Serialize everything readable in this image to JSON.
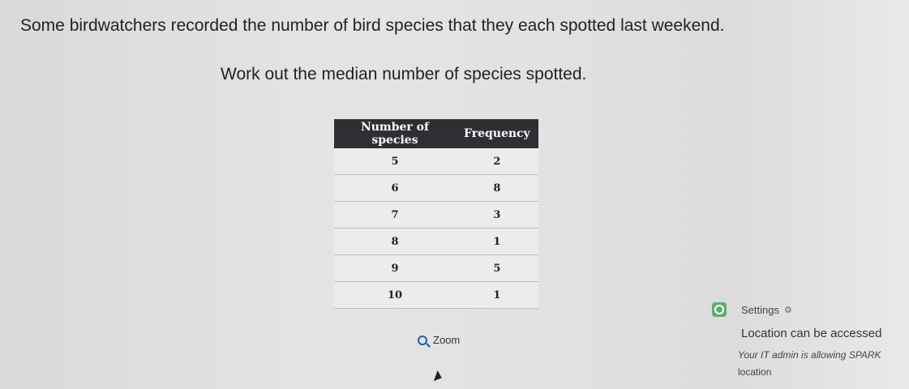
{
  "question": {
    "line1": "Some birdwatchers recorded the number of bird species that they each spotted last weekend.",
    "line2": "Work out the median number of species spotted."
  },
  "table": {
    "headers": [
      "Number of species",
      "Frequency"
    ],
    "rows": [
      [
        "5",
        "2"
      ],
      [
        "6",
        "8"
      ],
      [
        "7",
        "3"
      ],
      [
        "8",
        "1"
      ],
      [
        "9",
        "5"
      ],
      [
        "10",
        "1"
      ]
    ]
  },
  "zoom_label": "Zoom",
  "notification": {
    "settings_label": "Settings",
    "title": "Location can be accessed",
    "description": "Your IT admin is allowing SPARK",
    "description_cont": "location"
  },
  "colors": {
    "header_bg": "#2f2f33",
    "badge_green": "#5cae6a",
    "zoom_blue": "#1e5bb8"
  }
}
